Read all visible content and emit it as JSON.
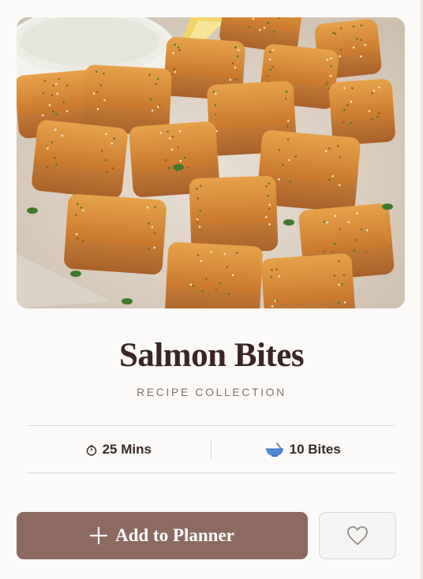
{
  "recipe": {
    "title": "Salmon Bites",
    "category": "RECIPE COLLECTION",
    "image_alt": "Crispy breaded salmon bites with a dip and lemon wedge"
  },
  "stats": {
    "time_label": "25 Mins",
    "time_icon": "timer-icon",
    "servings_label": "10 Bites",
    "servings_icon": "bowl-icon"
  },
  "actions": {
    "add_label": "Add to Planner",
    "add_icon": "plus-icon",
    "favorite_icon": "heart-icon"
  },
  "colors": {
    "accent": "#8c6a60",
    "title": "#3a2622",
    "subtitle": "#8a6f64",
    "background": "#fbfaf9"
  }
}
